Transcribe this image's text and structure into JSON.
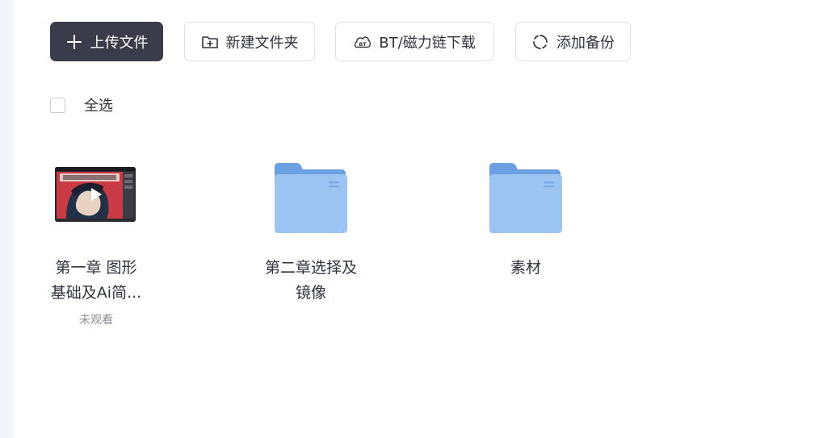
{
  "toolbar": {
    "upload_label": "上传文件",
    "new_folder_label": "新建文件夹",
    "bt_label": "BT/磁力链下载",
    "backup_label": "添加备份"
  },
  "select_all": {
    "label": "全选"
  },
  "files": [
    {
      "name_line1": "第一章 图形",
      "name_line2": "基础及Ai简...",
      "status": "未观看",
      "type": "video"
    },
    {
      "name_line1": "第二章选择及",
      "name_line2": "镜像",
      "type": "folder"
    },
    {
      "name_line1": "素材",
      "type": "folder"
    }
  ],
  "colors": {
    "primary_button": "#3a3c4a",
    "folder_front": "#8fbcf0",
    "folder_back": "#6a9fe2"
  },
  "icons": {
    "upload": "plus-icon",
    "new_folder": "folder-plus-icon",
    "bt": "bt-icon",
    "backup": "refresh-icon"
  }
}
